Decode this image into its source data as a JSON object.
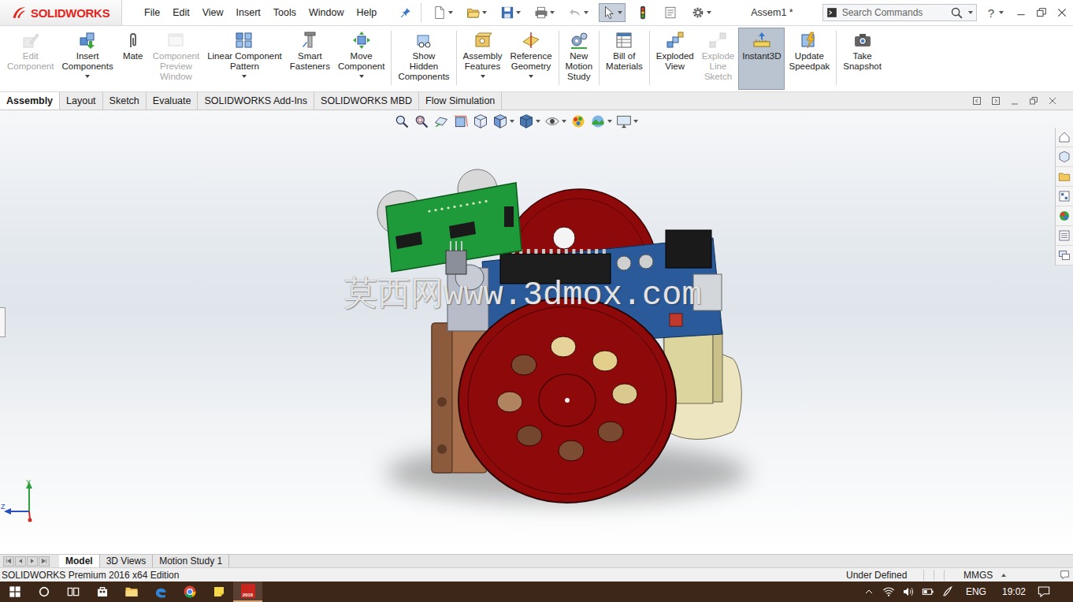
{
  "app": {
    "logo": "SOLIDWORKS"
  },
  "menu": [
    "File",
    "Edit",
    "View",
    "Insert",
    "Tools",
    "Window",
    "Help"
  ],
  "quick_access": {
    "select_selected": true
  },
  "window": {
    "title": "Assem1 *"
  },
  "search": {
    "placeholder": "Search Commands"
  },
  "help": {
    "label": "?"
  },
  "ribbon": {
    "groups": [
      {
        "buttons": [
          {
            "lines": [
              "Edit",
              "Component"
            ],
            "disabled": true,
            "selected": false,
            "dropdown": false
          },
          {
            "lines": [
              "Insert",
              "Components"
            ],
            "disabled": false,
            "selected": false,
            "dropdown": true
          },
          {
            "lines": [
              "Mate"
            ],
            "disabled": false,
            "selected": false,
            "dropdown": false
          },
          {
            "lines": [
              "Component",
              "Preview",
              "Window"
            ],
            "disabled": true,
            "selected": false,
            "dropdown": false
          },
          {
            "lines": [
              "Linear Component",
              "Pattern"
            ],
            "disabled": false,
            "selected": false,
            "dropdown": true
          },
          {
            "lines": [
              "Smart",
              "Fasteners"
            ],
            "disabled": false,
            "selected": false,
            "dropdown": false
          },
          {
            "lines": [
              "Move",
              "Component"
            ],
            "disabled": false,
            "selected": false,
            "dropdown": true
          }
        ]
      },
      {
        "buttons": [
          {
            "lines": [
              "Show",
              "Hidden",
              "Components"
            ],
            "disabled": false,
            "selected": false,
            "dropdown": false
          }
        ]
      },
      {
        "buttons": [
          {
            "lines": [
              "Assembly",
              "Features"
            ],
            "disabled": false,
            "selected": false,
            "dropdown": true
          },
          {
            "lines": [
              "Reference",
              "Geometry"
            ],
            "disabled": false,
            "selected": false,
            "dropdown": true
          }
        ]
      },
      {
        "buttons": [
          {
            "lines": [
              "New",
              "Motion",
              "Study"
            ],
            "disabled": false,
            "selected": false,
            "dropdown": false
          }
        ]
      },
      {
        "buttons": [
          {
            "lines": [
              "Bill of",
              "Materials"
            ],
            "disabled": false,
            "selected": false,
            "dropdown": false
          }
        ]
      },
      {
        "buttons": [
          {
            "lines": [
              "Exploded",
              "View"
            ],
            "disabled": false,
            "selected": false,
            "dropdown": false
          },
          {
            "lines": [
              "Explode",
              "Line",
              "Sketch"
            ],
            "disabled": true,
            "selected": false,
            "dropdown": false
          },
          {
            "lines": [
              "Instant3D"
            ],
            "disabled": false,
            "selected": true,
            "dropdown": false
          },
          {
            "lines": [
              "Update",
              "Speedpak"
            ],
            "disabled": false,
            "selected": false,
            "dropdown": false
          }
        ]
      },
      {
        "buttons": [
          {
            "lines": [
              "Take",
              "Snapshot"
            ],
            "disabled": false,
            "selected": false,
            "dropdown": false
          }
        ]
      }
    ]
  },
  "tabs": [
    {
      "label": "Assembly",
      "selected": true
    },
    {
      "label": "Layout",
      "selected": false
    },
    {
      "label": "Sketch",
      "selected": false
    },
    {
      "label": "Evaluate",
      "selected": false
    },
    {
      "label": "SOLIDWORKS Add-Ins",
      "selected": false
    },
    {
      "label": "SOLIDWORKS MBD",
      "selected": false
    },
    {
      "label": "Flow Simulation",
      "selected": false
    }
  ],
  "viewport": {
    "watermark": "莫西网www.3dmox.com",
    "triad": {
      "y_label": "Y",
      "z_label": "Z"
    }
  },
  "bottom_tabs": [
    {
      "label": "Model",
      "selected": true
    },
    {
      "label": "3D Views",
      "selected": false
    },
    {
      "label": "Motion Study 1",
      "selected": false
    }
  ],
  "status_bar": {
    "product": "SOLIDWORKS Premium 2016 x64 Edition",
    "state": "Under Defined",
    "units": "MMGS"
  },
  "taskbar": {
    "app_badge": "2016",
    "language": "ENG",
    "time": "19:02"
  }
}
